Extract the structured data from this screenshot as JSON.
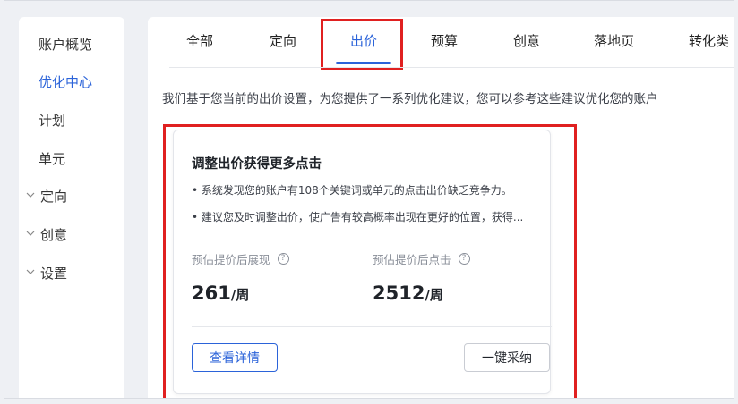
{
  "sidebar": {
    "items": [
      {
        "label": "账户概览",
        "active": false,
        "expandable": false
      },
      {
        "label": "优化中心",
        "active": true,
        "expandable": false
      },
      {
        "label": "计划",
        "active": false,
        "expandable": false
      },
      {
        "label": "单元",
        "active": false,
        "expandable": false
      },
      {
        "label": "定向",
        "active": false,
        "expandable": true
      },
      {
        "label": "创意",
        "active": false,
        "expandable": true
      },
      {
        "label": "设置",
        "active": false,
        "expandable": true
      }
    ]
  },
  "tabs": {
    "items": [
      {
        "label": "全部"
      },
      {
        "label": "定向"
      },
      {
        "label": "出价"
      },
      {
        "label": "预算"
      },
      {
        "label": "创意"
      },
      {
        "label": "落地页"
      },
      {
        "label": "转化类"
      }
    ],
    "active_tab": "出价"
  },
  "description": "我们基于您当前的出价设置，为您提供了一系列优化建议，您可以参考这些建议优化您的账户",
  "card": {
    "title": "调整出价获得更多点击",
    "bullets": [
      "• 系统发现您的账户有108个关键词或单元的点击出价缺乏竞争力。",
      "• 建议您及时调整出价，使广告有较高概率出现在更好的位置，获得..."
    ],
    "metrics": [
      {
        "label": "预估提价后展现",
        "value": "261",
        "unit": "/周"
      },
      {
        "label": "预估提价后点击",
        "value": "2512",
        "unit": "/周"
      }
    ],
    "help_icon_glyph": "?",
    "detail_button": "查看详情",
    "adopt_button": "一键采纳"
  },
  "colors": {
    "accent": "#2b63d9",
    "highlight_box": "#e02020"
  }
}
